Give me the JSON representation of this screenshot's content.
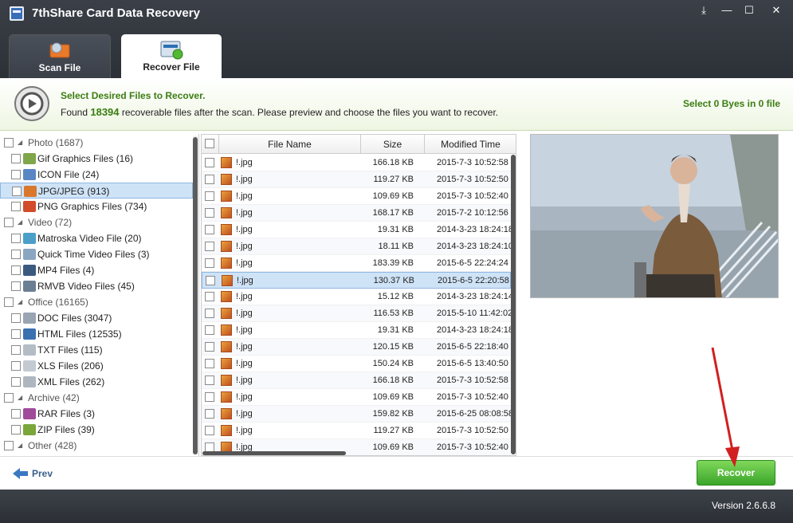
{
  "app": {
    "title": "7thShare Card Data Recovery",
    "window_buttons": [
      "⤓",
      "—",
      "☐",
      "✕"
    ]
  },
  "tabs": [
    {
      "label": "Scan File"
    },
    {
      "label": "Recover File"
    }
  ],
  "info": {
    "heading": "Select Desired Files to Recover.",
    "found_prefix": "Found ",
    "found_count": "18394",
    "found_suffix": " recoverable files after the scan. Please preview and choose the files you want to recover.",
    "selection": "Select 0 Byes in 0 file"
  },
  "tree": {
    "items": [
      {
        "label": "Photo (1687)",
        "level": 0,
        "icon": "none"
      },
      {
        "label": "Gif Graphics Files (16)",
        "level": 1,
        "icon": "gif-file-icon"
      },
      {
        "label": "ICON File (24)",
        "level": 1,
        "icon": "ico-file-icon"
      },
      {
        "label": "JPG/JPEG (913)",
        "level": 1,
        "icon": "jpg-file-icon",
        "selected": true
      },
      {
        "label": "PNG Graphics Files (734)",
        "level": 1,
        "icon": "png-file-icon"
      },
      {
        "label": "Video (72)",
        "level": 0,
        "icon": "none"
      },
      {
        "label": "Matroska Video File (20)",
        "level": 1,
        "icon": "mkv-file-icon"
      },
      {
        "label": "Quick Time Video Files (3)",
        "level": 1,
        "icon": "mov-file-icon"
      },
      {
        "label": "MP4 Files (4)",
        "level": 1,
        "icon": "mp4-file-icon"
      },
      {
        "label": "RMVB Video Files (45)",
        "level": 1,
        "icon": "rmvb-file-icon"
      },
      {
        "label": "Office (16165)",
        "level": 0,
        "icon": "none"
      },
      {
        "label": "DOC Files (3047)",
        "level": 1,
        "icon": "doc-file-icon"
      },
      {
        "label": "HTML Files (12535)",
        "level": 1,
        "icon": "html-file-icon"
      },
      {
        "label": "TXT Files (115)",
        "level": 1,
        "icon": "txt-file-icon"
      },
      {
        "label": "XLS Files (206)",
        "level": 1,
        "icon": "xls-file-icon"
      },
      {
        "label": "XML Files (262)",
        "level": 1,
        "icon": "xml-file-icon"
      },
      {
        "label": "Archive (42)",
        "level": 0,
        "icon": "none"
      },
      {
        "label": "RAR Files (3)",
        "level": 1,
        "icon": "rar-file-icon"
      },
      {
        "label": "ZIP Files (39)",
        "level": 1,
        "icon": "zip-file-icon"
      },
      {
        "label": "Other (428)",
        "level": 0,
        "icon": "none"
      }
    ]
  },
  "table": {
    "headers": [
      "File Name",
      "Size",
      "Modified Time"
    ],
    "rows": [
      {
        "name": "!.jpg",
        "size": "166.18 KB",
        "time": "2015-7-3 10:52:58"
      },
      {
        "name": "!.jpg",
        "size": "119.27 KB",
        "time": "2015-7-3 10:52:50"
      },
      {
        "name": "!.jpg",
        "size": "109.69 KB",
        "time": "2015-7-3 10:52:40"
      },
      {
        "name": "!.jpg",
        "size": "168.17 KB",
        "time": "2015-7-2 10:12:56"
      },
      {
        "name": "!.jpg",
        "size": "19.31 KB",
        "time": "2014-3-23 18:24:18"
      },
      {
        "name": "!.jpg",
        "size": "18.11 KB",
        "time": "2014-3-23 18:24:10"
      },
      {
        "name": "!.jpg",
        "size": "183.39 KB",
        "time": "2015-6-5 22:24:24"
      },
      {
        "name": "!.jpg",
        "size": "130.37 KB",
        "time": "2015-6-5 22:20:58",
        "selected": true
      },
      {
        "name": "!.jpg",
        "size": "15.12 KB",
        "time": "2014-3-23 18:24:14"
      },
      {
        "name": "!.jpg",
        "size": "116.53 KB",
        "time": "2015-5-10 11:42:02"
      },
      {
        "name": "!.jpg",
        "size": "19.31 KB",
        "time": "2014-3-23 18:24:18"
      },
      {
        "name": "!.jpg",
        "size": "120.15 KB",
        "time": "2015-6-5 22:18:40"
      },
      {
        "name": "!.jpg",
        "size": "150.24 KB",
        "time": "2015-6-5 13:40:50"
      },
      {
        "name": "!.jpg",
        "size": "166.18 KB",
        "time": "2015-7-3 10:52:58"
      },
      {
        "name": "!.jpg",
        "size": "109.69 KB",
        "time": "2015-7-3 10:52:40"
      },
      {
        "name": "!.jpg",
        "size": "159.82 KB",
        "time": "2015-6-25 08:08:58"
      },
      {
        "name": "!.jpg",
        "size": "119.27 KB",
        "time": "2015-7-3 10:52:50"
      },
      {
        "name": "!.jpg",
        "size": "109.69 KB",
        "time": "2015-7-3 10:52:40"
      }
    ]
  },
  "buttons": {
    "prev": "Prev",
    "recover": "Recover"
  },
  "footer": {
    "version": "Version 2.6.6.8"
  },
  "colors": {
    "accent_green": "#3b7d12",
    "selection_blue": "#cfe3f7",
    "titlebar": "#2c3037"
  }
}
